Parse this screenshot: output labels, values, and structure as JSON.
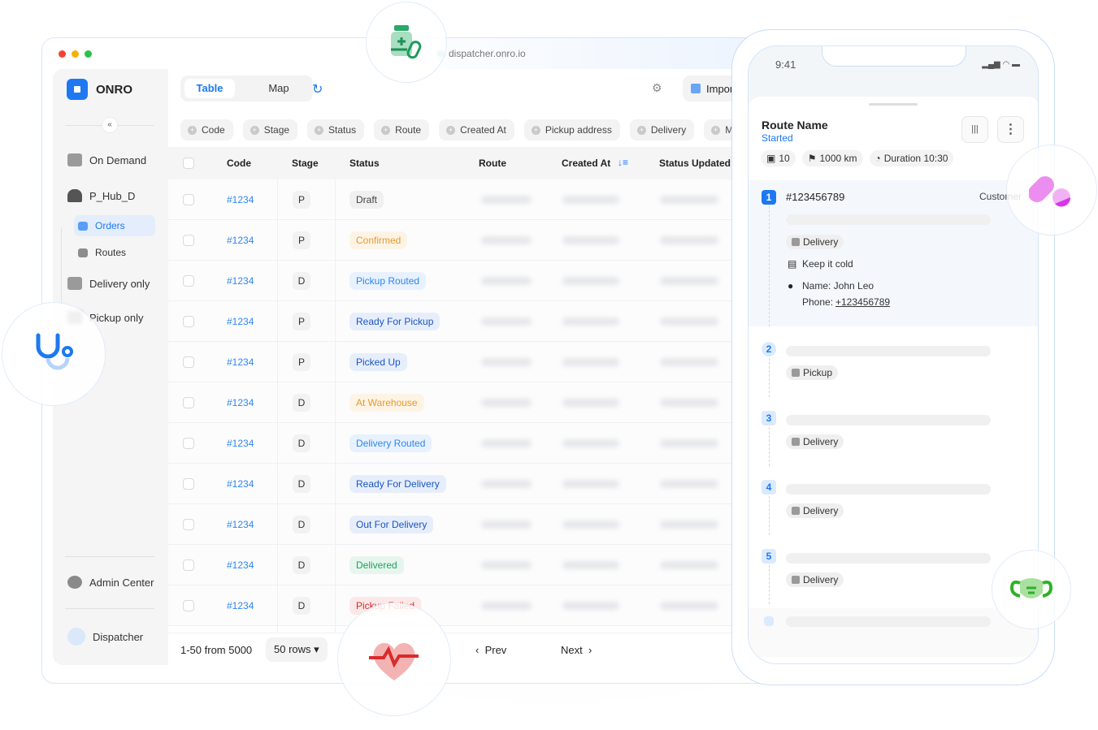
{
  "browser": {
    "url": "dispatcher.onro.io",
    "traffic_lights": [
      "#f44336",
      "#f5b300",
      "#2bc24a"
    ]
  },
  "sidebar": {
    "brand": "ONRO",
    "collapse_icon": "chevrons-left-icon",
    "items": [
      {
        "label": "On Demand",
        "icon": "box-icon"
      },
      {
        "label": "P_Hub_D",
        "icon": "warehouse-icon"
      },
      {
        "label": "Orders",
        "icon": "grid-icon",
        "active": true
      },
      {
        "label": "Routes",
        "icon": "grid-icon"
      },
      {
        "label": "Delivery only",
        "icon": "delivery-box-icon"
      },
      {
        "label": "Pickup only",
        "icon": "pickup-box-icon"
      }
    ],
    "admin": "Admin Center",
    "user": "Dispatcher"
  },
  "toolbar": {
    "tabs": [
      "Table",
      "Map"
    ],
    "active_tab": "Table",
    "import_label": "Import"
  },
  "filters": [
    "Code",
    "Stage",
    "Status",
    "Route",
    "Created At",
    "Pickup address",
    "Delivery",
    "M"
  ],
  "table": {
    "columns": [
      "Code",
      "Stage",
      "Status",
      "Route",
      "Created At",
      "Status Updated"
    ],
    "sort_column": "Created At",
    "rows": [
      {
        "code": "#1234",
        "stage": "P",
        "status": "Draft",
        "tone": "gray"
      },
      {
        "code": "#1234",
        "stage": "P",
        "status": "Confirmed",
        "tone": "orange"
      },
      {
        "code": "#1234",
        "stage": "D",
        "status": "Pickup Routed",
        "tone": "lightblue"
      },
      {
        "code": "#1234",
        "stage": "P",
        "status": "Ready For Pickup",
        "tone": "darkblue"
      },
      {
        "code": "#1234",
        "stage": "P",
        "status": "Picked Up",
        "tone": "darkblue"
      },
      {
        "code": "#1234",
        "stage": "D",
        "status": "At Warehouse",
        "tone": "orange"
      },
      {
        "code": "#1234",
        "stage": "D",
        "status": "Delivery Routed",
        "tone": "lightblue"
      },
      {
        "code": "#1234",
        "stage": "D",
        "status": "Ready For Delivery",
        "tone": "darkblue"
      },
      {
        "code": "#1234",
        "stage": "D",
        "status": "Out For Delivery",
        "tone": "darkblue"
      },
      {
        "code": "#1234",
        "stage": "D",
        "status": "Delivered",
        "tone": "green"
      },
      {
        "code": "#1234",
        "stage": "D",
        "status": "Pickup Failed",
        "tone": "red"
      }
    ]
  },
  "pagination": {
    "range": "1-50 from 5000",
    "rows_per_page": "50 rows",
    "prev": "Prev",
    "next": "Next"
  },
  "tones": {
    "gray": {
      "bg": "#f0f0f1",
      "fg": "#444444"
    },
    "orange": {
      "bg": "#fdf4e6",
      "fg": "#e89a2c"
    },
    "lightblue": {
      "bg": "#e8f2fe",
      "fg": "#2f86f0"
    },
    "darkblue": {
      "bg": "#e7eefb",
      "fg": "#1b55c2"
    },
    "green": {
      "bg": "#e6f6ee",
      "fg": "#1fa25a"
    },
    "red": {
      "bg": "#fde8e8",
      "fg": "#d92b2b"
    }
  },
  "phone": {
    "time": "9:41",
    "route_name": "Route Name",
    "route_status": "Started",
    "stats": {
      "stops": "10",
      "distance": "1000 km",
      "duration": "Duration 10:30"
    },
    "stops": [
      {
        "n": "1",
        "id": "#123456789",
        "customer": "Customer",
        "type": "Delivery",
        "note": "Keep it cold",
        "name": "Name: John Leo",
        "phone_label": "Phone:",
        "phone": "+123456789"
      },
      {
        "n": "2",
        "type": "Pickup"
      },
      {
        "n": "3",
        "type": "Delivery"
      },
      {
        "n": "4",
        "type": "Delivery"
      },
      {
        "n": "5",
        "type": "Delivery"
      }
    ]
  },
  "decor": [
    "medicine-bottle-icon",
    "stethoscope-icon",
    "heart-pulse-icon",
    "pills-icon",
    "face-mask-icon"
  ]
}
